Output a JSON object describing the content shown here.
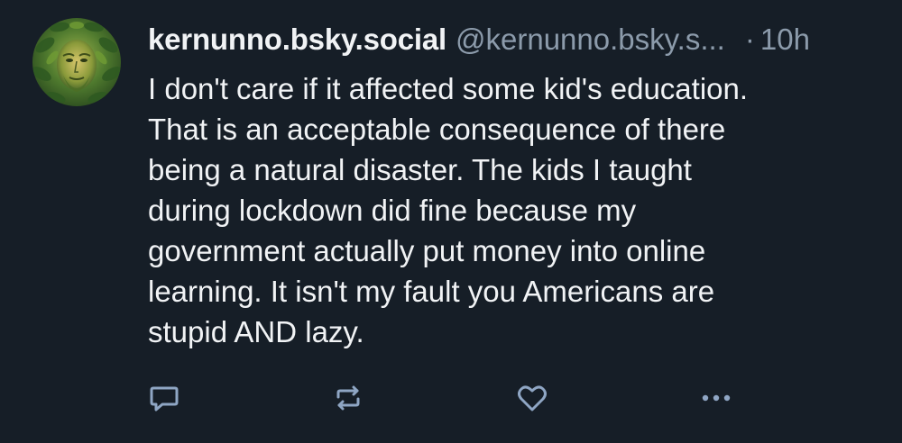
{
  "post": {
    "display_name": "kernunno.bsky.social",
    "handle": "@kernunno.bsky.s...",
    "separator": "·",
    "time": "10h",
    "text": "I don't care if it affected some kid's education.\nThat is an acceptable consequence of there\nbeing a natural disaster. The kids I taught\nduring lockdown did fine because my\ngovernment actually put money into online\nlearning. It isn't my fault you Americans are\nstupid AND lazy."
  },
  "actions": [
    {
      "icon": "reply-icon"
    },
    {
      "icon": "repost-icon"
    },
    {
      "icon": "like-icon"
    },
    {
      "icon": "more-options-icon"
    }
  ],
  "colors": {
    "background": "#161e27",
    "text": "#f1f3f5",
    "muted": "#8c9bab",
    "icon": "#8fa6c4"
  }
}
